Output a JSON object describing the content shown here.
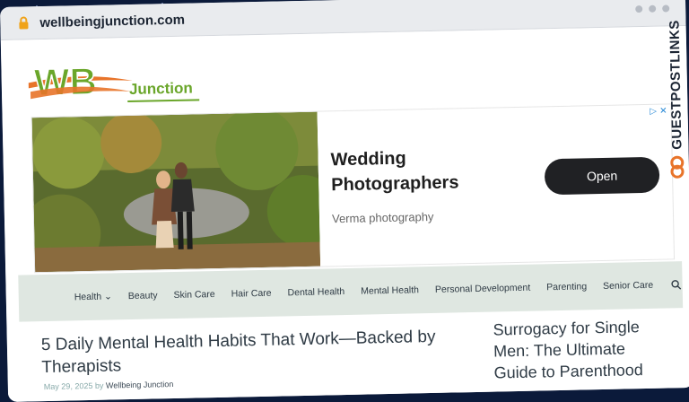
{
  "browser": {
    "url": "wellbeingjunction.com"
  },
  "logo": {
    "mark": "WB",
    "name": "Junction"
  },
  "ad": {
    "title_line1": "Wedding",
    "title_line2": "Photographers",
    "advertiser": "Verma photography",
    "cta": "Open",
    "adchoices": "▷ ✕"
  },
  "nav": {
    "items": [
      "Health",
      "Beauty",
      "Skin Care",
      "Hair Care",
      "Dental Health",
      "Mental Health",
      "Personal Development",
      "Parenting",
      "Senior Care"
    ]
  },
  "post": {
    "title": "5 Daily Mental Health Habits That Work—Backed by Therapists",
    "date": "May 29, 2025",
    "by": "by",
    "author": "Wellbeing Junction"
  },
  "sidebar": {
    "title": "Surrogacy for Single Men: The Ultimate Guide to Parenthood"
  },
  "ribbon": {
    "text": "GUESTPOSTLINKS"
  },
  "colors": {
    "accent_green": "#6aa62a",
    "logo_orange": "#e8742a",
    "nav_bg": "#dfe7e1",
    "background": "#0b1a3a"
  }
}
